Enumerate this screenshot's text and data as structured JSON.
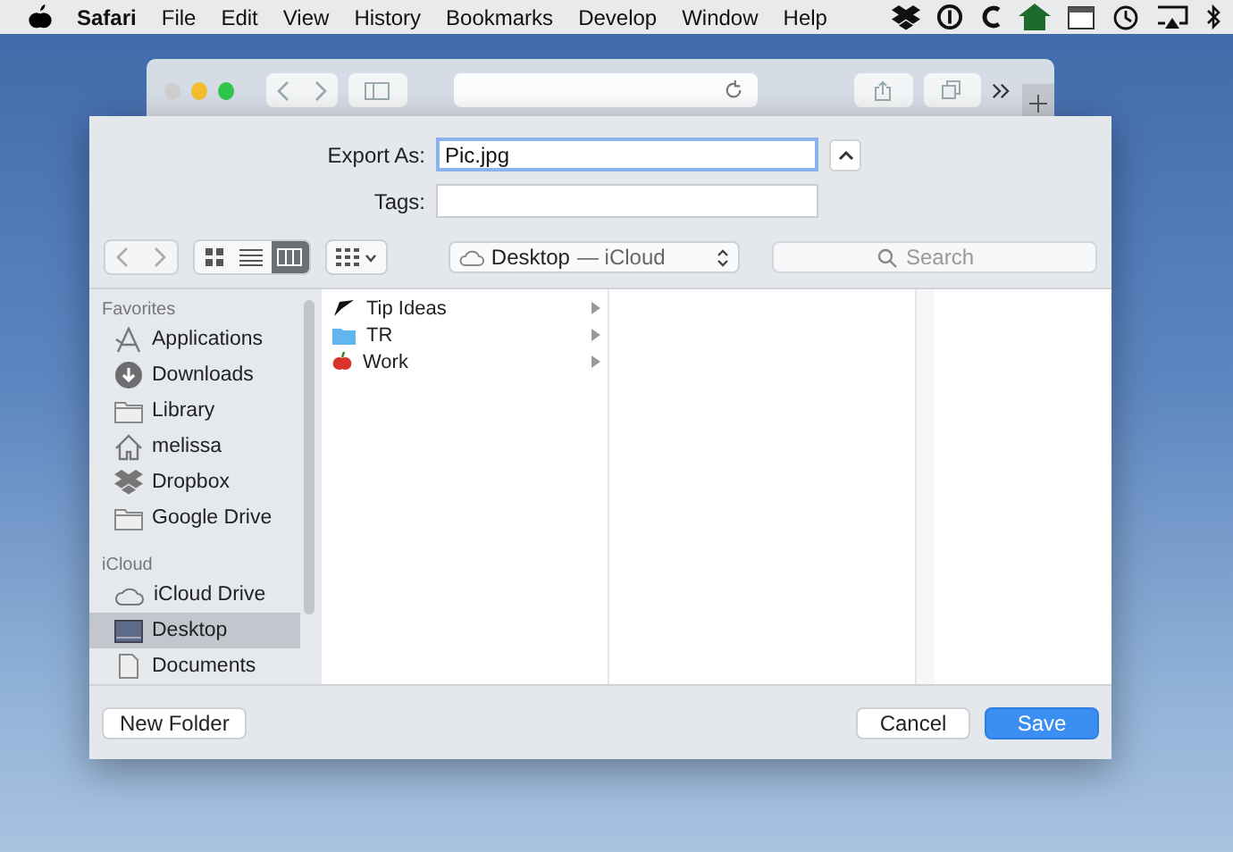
{
  "menu_bar": {
    "items": [
      {
        "label": "Safari",
        "kind": "app"
      },
      {
        "label": "File",
        "kind": "menu"
      },
      {
        "label": "Edit",
        "kind": "menu"
      },
      {
        "label": "View",
        "kind": "menu"
      },
      {
        "label": "History",
        "kind": "menu"
      },
      {
        "label": "Bookmarks",
        "kind": "menu"
      },
      {
        "label": "Develop",
        "kind": "menu"
      },
      {
        "label": "Window",
        "kind": "menu"
      },
      {
        "label": "Help",
        "kind": "menu"
      }
    ]
  },
  "dialog": {
    "export_as": {
      "label": "Export As:",
      "value": "Pic.jpg"
    },
    "tags": {
      "label": "Tags:"
    },
    "view_modes": [
      {
        "kind": "icons",
        "selected": false
      },
      {
        "kind": "list",
        "selected": false
      },
      {
        "kind": "columns",
        "selected": true
      }
    ],
    "location": {
      "name": "Desktop",
      "source": "— iCloud"
    },
    "search": {
      "placeholder": "Search"
    },
    "sidebar": [
      {
        "title": "Favorites",
        "items": [
          {
            "label": "Applications",
            "kind": "apps",
            "selected": false
          },
          {
            "label": "Downloads",
            "kind": "download",
            "selected": false
          },
          {
            "label": "Library",
            "kind": "folder",
            "selected": false
          },
          {
            "label": "melissa",
            "kind": "home",
            "selected": false
          },
          {
            "label": "Dropbox",
            "kind": "dropbox",
            "selected": false
          },
          {
            "label": "Google Drive",
            "kind": "folder",
            "selected": false
          }
        ]
      },
      {
        "title": "iCloud",
        "items": [
          {
            "label": "iCloud Drive",
            "kind": "cloud",
            "selected": false
          },
          {
            "label": "Desktop",
            "kind": "desktop",
            "selected": true
          },
          {
            "label": "Documents",
            "kind": "docs",
            "selected": false
          }
        ]
      }
    ],
    "files": [
      {
        "name": "Tip Ideas",
        "kind": "pen"
      },
      {
        "name": "TR",
        "kind": "folder"
      },
      {
        "name": "Work",
        "kind": "apple"
      }
    ],
    "buttons": [
      {
        "label": "New Folder",
        "kind": "plain"
      },
      {
        "label": "Cancel",
        "kind": "plain"
      },
      {
        "label": "Save",
        "kind": "default"
      }
    ]
  }
}
